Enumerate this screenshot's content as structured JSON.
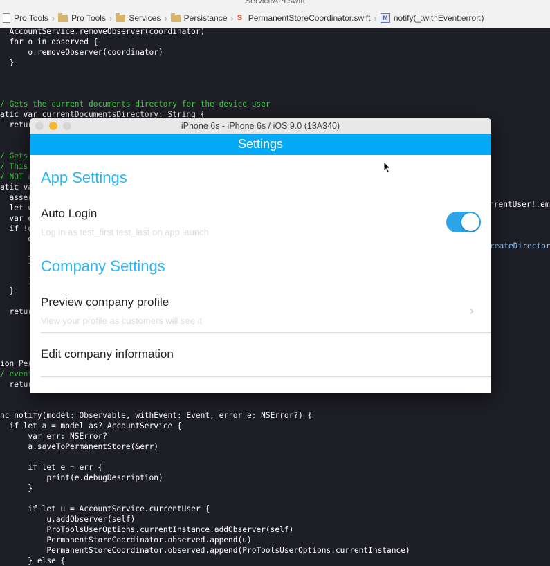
{
  "xcode": {
    "tab_title": "ServiceAPI.swift",
    "breadcrumbs": [
      "Pro Tools",
      "Pro Tools",
      "Services",
      "Persistance",
      "PermanentStoreCoordinator.swift",
      "notify(_:withEvent:error:)"
    ]
  },
  "code_lines": [
    "  AccountService.removeObserver(coordinator)",
    "  for o in observed {",
    "      o.removeObserver(coordinator)",
    "  }",
    "/ Gets the current documents directory for the device user",
    "atic var currentDocumentsDirectory: String {",
    "  retur",
    "/ Gets",
    "/ This",
    "/ NOT a",
    "atic va",
    "  asser",
    "  let u",
    "  var e",
    "  if !u",
    "      d",
    "      }",
    "      }",
    "  }",
    "  retur",
    "ion Per",
    "/ event",
    "  retur",
    "nc notify(model: Observable, withEvent: Event, error e: NSError?) {",
    "  if let a = model as? AccountService {",
    "      var err: NSError?",
    "      a.saveToPermanentStore(&err)",
    "      if let e = err {",
    "          print(e.debugDescription)",
    "      }",
    "      if let u = AccountService.currentUser {",
    "          u.addObserver(self)",
    "          ProToolsUserOptions.currentInstance.addObserver(self)",
    "          PermanentStoreCoordinator.observed.append(u)",
    "          PermanentStoreCoordinator.observed.append(ProToolsUserOptions.currentInstance)",
    "      } else {"
  ],
  "code_right_fragments": [
    "rrentUser!.ema",
    "reateDirectory"
  ],
  "simulator": {
    "window_title": "iPhone 6s - iPhone 6s / iOS 9.0 (13A340)",
    "nav_title": "Settings",
    "sections": [
      {
        "header": "App Settings",
        "rows": [
          {
            "title": "Auto Login",
            "subtitle": "Log in as test_first test_last on app launch",
            "toggle_on": true
          }
        ]
      },
      {
        "header": "Company Settings",
        "rows": [
          {
            "title": "Preview company profile",
            "subtitle": "View your profile as customers will see it",
            "chevron": "›"
          },
          {
            "title": "Edit company information"
          }
        ]
      }
    ]
  },
  "colors": {
    "accent": "#03a9f4",
    "section_header": "#29b6f6",
    "toggle_on": "#2ba5e8",
    "code_bg": "#1e1f26",
    "comment": "#41cc45",
    "keyword": "#d35de6"
  }
}
